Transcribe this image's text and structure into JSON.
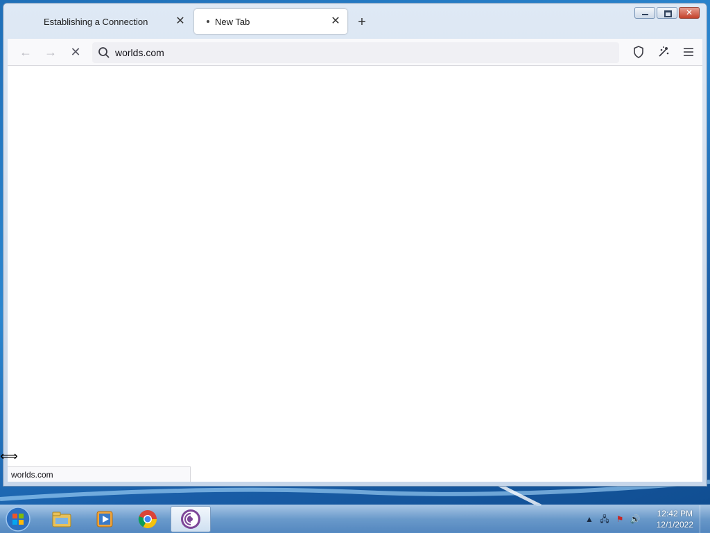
{
  "browser": {
    "tabs": [
      {
        "label": "Establishing a Connection",
        "active": false
      },
      {
        "label": "New Tab",
        "active": true
      }
    ],
    "new_tab_label": "+",
    "url": "worlds.com",
    "status_url": "worlds.com"
  },
  "taskbar": {
    "apps": [
      "explorer-icon",
      "media-player-icon",
      "chrome-icon",
      "tor-browser-icon"
    ],
    "clock": {
      "time": "12:42 PM",
      "date": "12/1/2022"
    }
  },
  "colors": {
    "accent": "#1f6fb8",
    "close": "#c4412b"
  }
}
